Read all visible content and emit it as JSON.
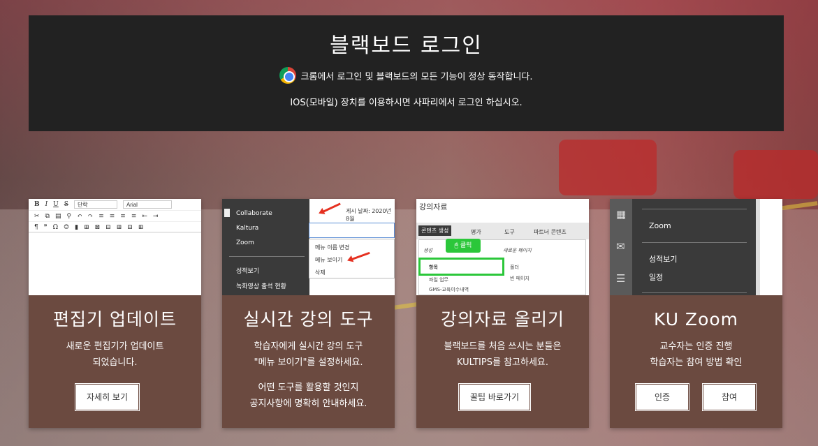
{
  "header": {
    "title": "블랙보드 로그인",
    "notice_chrome": "크롬에서 로그인 및 블랙보드의 모든 기능이 정상 동작합니다.",
    "notice_ios": "IOS(모바일) 장치를 이용하시면 사파리에서 로그인 하십시오."
  },
  "cards": [
    {
      "title": "편집기 업데이트",
      "desc_line1": "새로운 편집기가 업데이트",
      "desc_line2": "되었습니다.",
      "button": "자세히 보기",
      "shot": {
        "font_select": "단락",
        "family_select": "Arial"
      }
    },
    {
      "title": "실시간 강의 도구",
      "desc_line1": "학습자에게 실시간 강의 도구",
      "desc_line2": "\"메뉴 보이기\"를 설정하세요.",
      "desc_line3": "어떤 도구를 활용할 것인지",
      "desc_line4": "공지사항에 명확히 안내하세요.",
      "shot": {
        "side_items": [
          "Collaborate",
          "Kaltura",
          "Zoom",
          "성적보기",
          "녹화영상 출석 현황"
        ],
        "posted_date": "게시 날짜: 2020년 8월",
        "menu_items": [
          "메뉴 이름 변경",
          "메뉴 보이기",
          "삭제"
        ]
      }
    },
    {
      "title": "강의자료 올리기",
      "desc_line1": "블랙보드를 처음 쓰시는 분들은",
      "desc_line2": "KULTIPS를 참고하세요.",
      "button": "꿀팁 바로가기",
      "shot": {
        "page_title": "강의자료",
        "tabs": [
          "콘텐츠 생성",
          "평가",
          "도구",
          "파트너 콘텐츠"
        ],
        "col1_header": "생성",
        "col2_header": "새로운 페이지",
        "col1_items": [
          "항목",
          "파일 업무",
          "GMS-교육이수내역"
        ],
        "col2_items": [
          "폴더",
          "빈 페이지"
        ],
        "badge": "클릭"
      }
    },
    {
      "title": "KU Zoom",
      "desc_line1": "교수자는 인증 진행",
      "desc_line2": "학습자는 참여 방법 확인",
      "button_auth": "인증",
      "button_join": "참여",
      "shot": {
        "menu_items": [
          "Zoom",
          "성적보기",
          "일정"
        ]
      }
    }
  ]
}
